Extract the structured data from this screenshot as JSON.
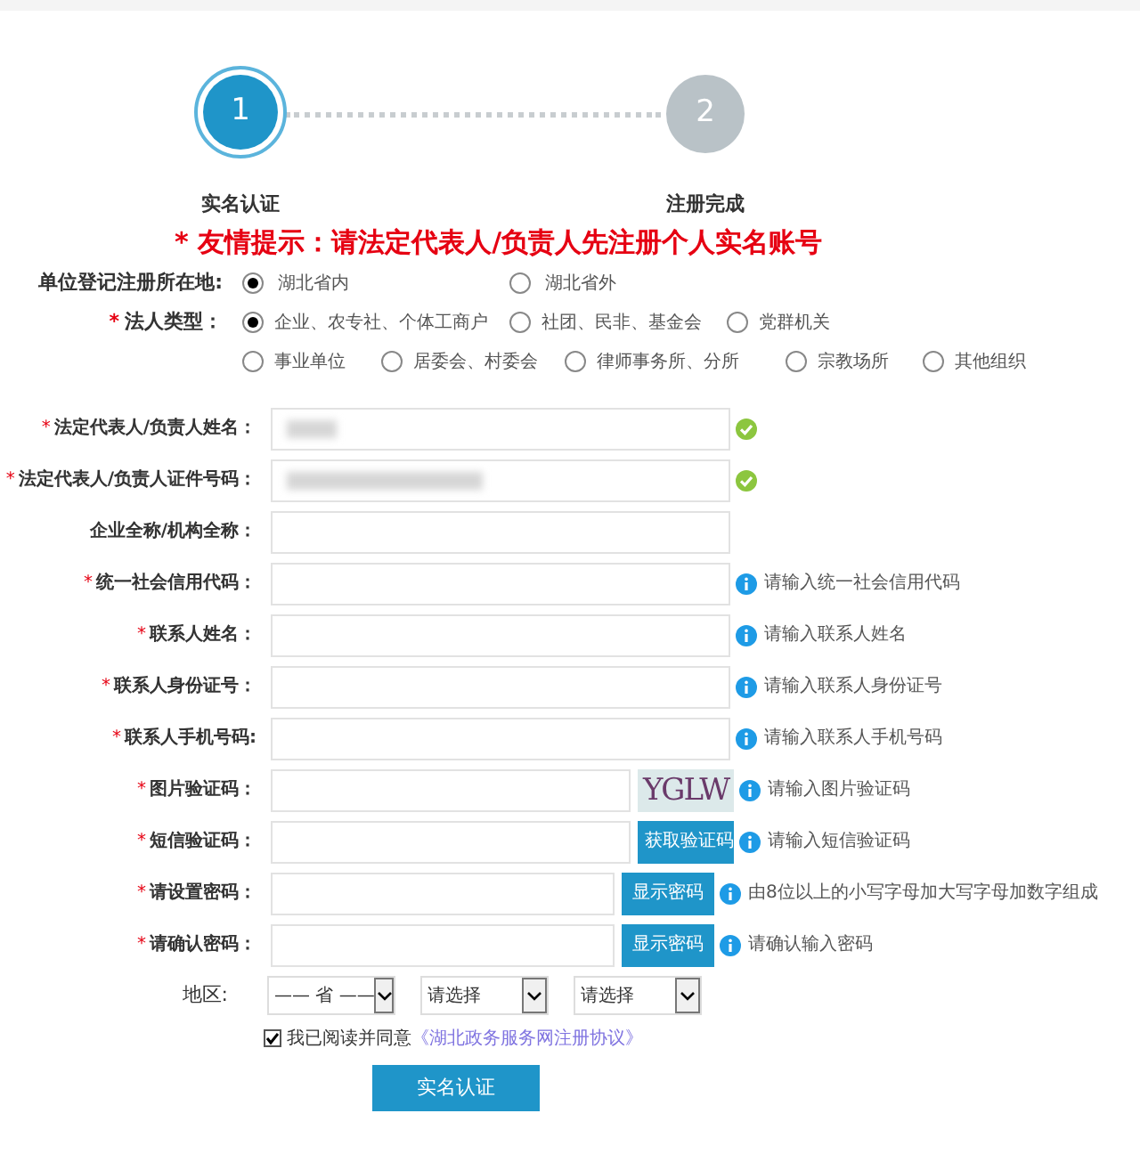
{
  "steps": [
    {
      "number": "1",
      "label": "实名认证",
      "selected": true
    },
    {
      "number": "2",
      "label": "注册完成",
      "selected": false
    }
  ],
  "notice": "* 友情提示：请法定代表人/负责人先注册个人实名账号",
  "location": {
    "label": "单位登记注册所在地:",
    "options": [
      {
        "label": "湖北省内",
        "selected": true
      },
      {
        "label": "湖北省外",
        "selected": false
      }
    ]
  },
  "entity_type": {
    "mark": "*",
    "label": "法人类型：",
    "options": [
      {
        "label": "企业、农专社、个体工商户",
        "selected": true
      },
      {
        "label": "社团、民非、基金会",
        "selected": false
      },
      {
        "label": "党群机关",
        "selected": false
      },
      {
        "label": "事业单位",
        "selected": false
      },
      {
        "label": "居委会、村委会",
        "selected": false
      },
      {
        "label": "律师事务所、分所",
        "selected": false
      },
      {
        "label": "宗教场所",
        "selected": false
      },
      {
        "label": "其他组织",
        "selected": false
      }
    ]
  },
  "fields": [
    {
      "mark": "*",
      "label": "法定代表人/负责人姓名：",
      "kind": "verified",
      "long_value": false
    },
    {
      "mark": "*",
      "label": "法定代表人/负责人证件号码：",
      "kind": "verified",
      "long_value": true
    },
    {
      "label": "企业全称/机构全称：",
      "kind": "plain"
    },
    {
      "mark": "*",
      "label": "统一社会信用代码：",
      "kind": "hinted",
      "hint": "请输入统一社会信用代码"
    },
    {
      "mark": "*",
      "label": "联系人姓名：",
      "kind": "hinted",
      "hint": "请输入联系人姓名"
    },
    {
      "mark": "*",
      "label": "联系人身份证号：",
      "kind": "hinted",
      "hint": "请输入联系人身份证号"
    },
    {
      "mark": "*",
      "label": "联系人手机号码:",
      "kind": "hinted",
      "hint": "请输入联系人手机号码"
    },
    {
      "mark": "*",
      "label": "图片验证码：",
      "kind": "hinted",
      "hint": "请输入图片验证码",
      "addon": {
        "kind": "captcha",
        "text": "YGLW"
      }
    },
    {
      "mark": "*",
      "label": "短信验证码：",
      "kind": "hinted",
      "hint": "请输入短信验证码",
      "addon": {
        "kind": "button",
        "text": "获取验证码"
      }
    },
    {
      "mark": "*",
      "label": "请设置密码：",
      "kind": "hinted",
      "hint": "由8位以上的小写字母加大写字母加数字组成",
      "addon": {
        "kind": "button",
        "text": "显示密码"
      }
    },
    {
      "mark": "*",
      "label": "请确认密码：",
      "kind": "hinted",
      "hint": "请确认输入密码",
      "addon": {
        "kind": "button",
        "text": "显示密码"
      }
    }
  ],
  "region": {
    "label": "地区:",
    "selects": [
      "—— 省 ——",
      "请选择",
      "请选择"
    ]
  },
  "agreement": {
    "checked": true,
    "text": "我已阅读并同意",
    "link": "《湖北政务服务网注册协议》"
  },
  "submit": "实名认证"
}
